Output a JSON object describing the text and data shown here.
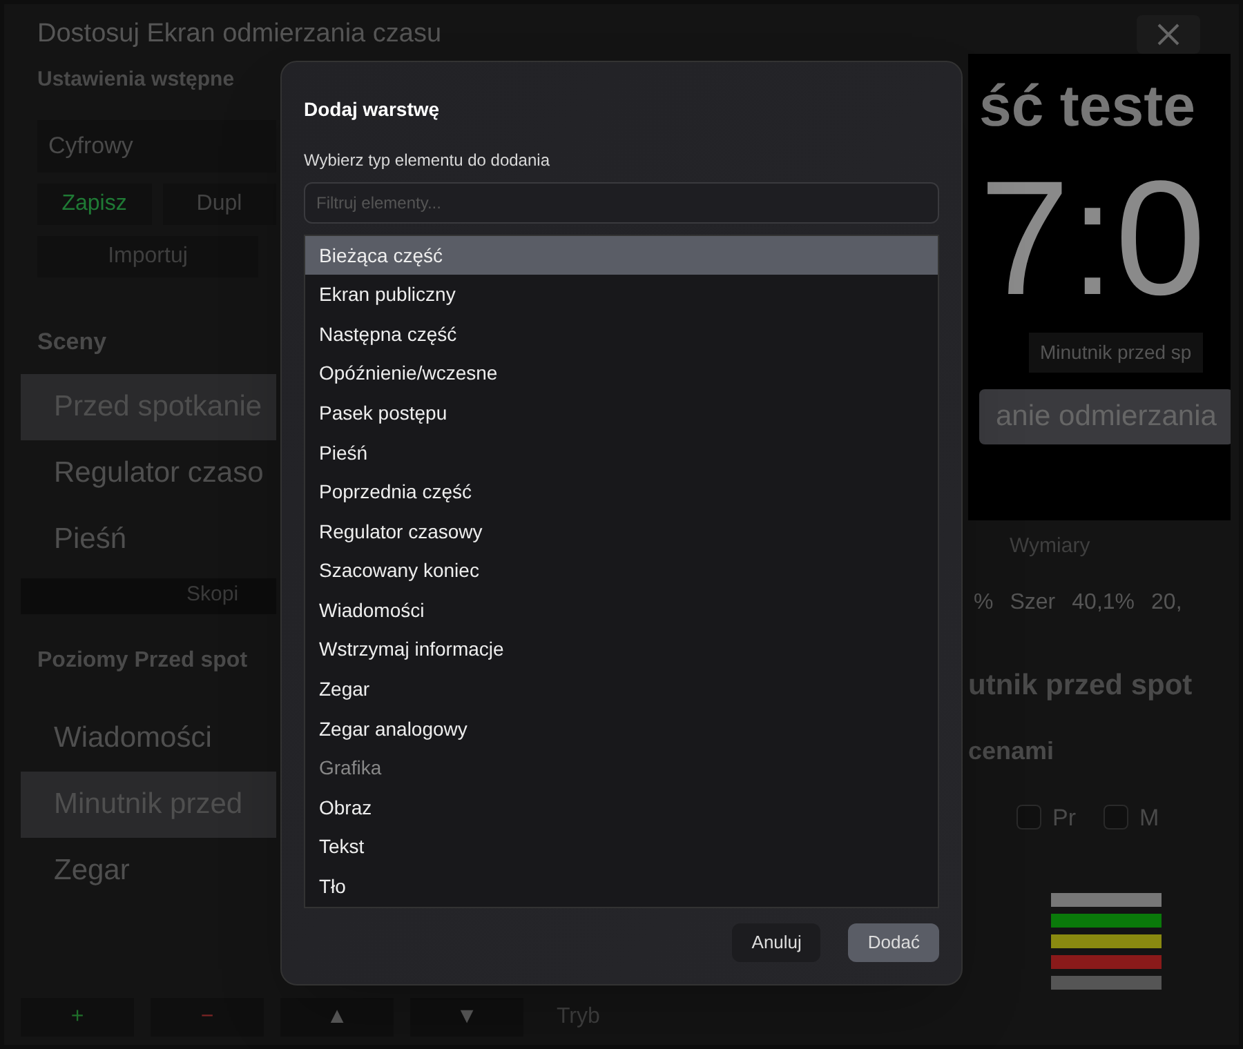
{
  "window": {
    "title": "Dostosuj Ekran odmierzania czasu"
  },
  "presets": {
    "heading": "Ustawienia wstępne",
    "value": "Cyfrowy",
    "buttons": [
      {
        "label": "Zapisz",
        "kind": "save"
      },
      {
        "label": "Dupl",
        "kind": "plain"
      }
    ],
    "import_button": "Importuj"
  },
  "scenes": {
    "heading": "Sceny",
    "items": [
      {
        "label": "Przed spotkanie",
        "selected": true
      },
      {
        "label": "Regulator czaso",
        "selected": false
      },
      {
        "label": "Pieśń",
        "selected": false
      }
    ],
    "copy_button": "Skopi"
  },
  "layers": {
    "heading": "Poziomy Przed spot",
    "items": [
      {
        "label": "Wiadomości",
        "selected": false
      },
      {
        "label": "Minutnik przed",
        "selected": true
      },
      {
        "label": "Zegar",
        "selected": false
      }
    ],
    "toolbar": [
      {
        "label": "+",
        "kind": "add"
      },
      {
        "label": "−",
        "kind": "remove"
      },
      {
        "label": "▲",
        "kind": "plain"
      },
      {
        "label": "▼",
        "kind": "plain"
      }
    ],
    "mode_label": "Tryb"
  },
  "preview": {
    "part_title": "ść teste",
    "clock": "7:0",
    "caption": "Minutnik przed sp",
    "button": "anie odmierzania"
  },
  "properties": {
    "dimensions_label": "Wymiary",
    "row": [
      "%",
      "Szer",
      "40,1%",
      "20,"
    ],
    "layer_title": "utnik przed spot",
    "section": "cenami",
    "checkboxes": [
      {
        "label": "Pr",
        "checked": false
      },
      {
        "label": "M",
        "checked": false
      }
    ]
  },
  "dialog": {
    "title": "Dodaj warstwę",
    "subtitle": "Wybierz typ elementu do dodania",
    "filter": {
      "placeholder": "Filtruj elementy..."
    },
    "items": [
      {
        "label": "Bieżąca część",
        "kind": "item",
        "selected": true
      },
      {
        "label": "Ekran publiczny",
        "kind": "item",
        "selected": false
      },
      {
        "label": "Następna część",
        "kind": "item",
        "selected": false
      },
      {
        "label": "Opóźnienie/wczesne",
        "kind": "item",
        "selected": false
      },
      {
        "label": "Pasek postępu",
        "kind": "item",
        "selected": false
      },
      {
        "label": "Pieśń",
        "kind": "item",
        "selected": false
      },
      {
        "label": "Poprzednia część",
        "kind": "item",
        "selected": false
      },
      {
        "label": "Regulator czasowy",
        "kind": "item",
        "selected": false
      },
      {
        "label": "Szacowany koniec",
        "kind": "item",
        "selected": false
      },
      {
        "label": "Wiadomości",
        "kind": "item",
        "selected": false
      },
      {
        "label": "Wstrzymaj informacje",
        "kind": "item",
        "selected": false
      },
      {
        "label": "Zegar",
        "kind": "item",
        "selected": false
      },
      {
        "label": "Zegar analogowy",
        "kind": "item",
        "selected": false
      },
      {
        "label": "Grafika",
        "kind": "header",
        "selected": false
      },
      {
        "label": "Obraz",
        "kind": "item",
        "selected": false
      },
      {
        "label": "Tekst",
        "kind": "item",
        "selected": false
      },
      {
        "label": "Tło",
        "kind": "item",
        "selected": false
      }
    ],
    "buttons": [
      {
        "label": "Anuluj",
        "kind": "secondary"
      },
      {
        "label": "Dodać",
        "kind": "primary"
      }
    ]
  }
}
